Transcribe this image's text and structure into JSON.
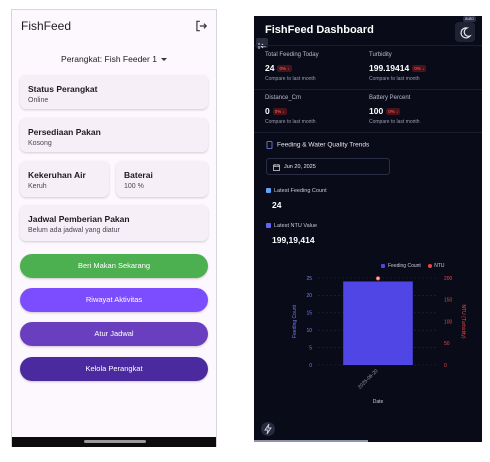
{
  "left_app": {
    "title": "FishFeed",
    "device_selector": "Perangkat: Fish Feeder 1",
    "cards": {
      "status": {
        "title": "Status Perangkat",
        "value": "Online"
      },
      "feed": {
        "title": "Persediaan Pakan",
        "value": "Kosong"
      },
      "turbidity": {
        "title": "Kekeruhan Air",
        "value": "Keruh"
      },
      "battery": {
        "title": "Baterai",
        "value": "100 %"
      },
      "schedule": {
        "title": "Jadwal Pemberian Pakan",
        "value": "Belum ada jadwal yang diatur"
      }
    },
    "buttons": {
      "feed_now": "Beri Makan Sekarang",
      "history": "Riwayat Aktivitas",
      "set_schedule": "Atur Jadwal",
      "manage_device": "Kelola Perangkat"
    },
    "colors": {
      "feed_now": "#4caf50",
      "history": "#7c4dff",
      "set_schedule": "#6a3fbf",
      "manage_device": "#4a2a9e"
    }
  },
  "right_app": {
    "title": "FishFeed Dashboard",
    "theme_badge": "auto",
    "stats": {
      "total_feeding": {
        "label": "Total Feeding Today",
        "value": "24",
        "change": "0%",
        "compare": "Compare to last month"
      },
      "turbidity": {
        "label": "Turbidity",
        "value": "199.19414",
        "change": "0%",
        "compare": "Compare to last month"
      },
      "distance": {
        "label": "Distance_Cm",
        "value": "0",
        "change": "0%",
        "compare": "Compare to last month"
      },
      "battery": {
        "label": "Battery Percent",
        "value": "100",
        "change": "0%",
        "compare": "Compare to last month"
      }
    },
    "section_title": "Feeding & Water Quality Trends",
    "date": "Jun 20, 2025",
    "latest_feeding": {
      "label": "Latest Feeding Count",
      "value": "24"
    },
    "latest_ntu": {
      "label": "Latest NTU Value",
      "value": "199,19,414"
    },
    "legend": {
      "feeding": "Feeding Count",
      "ntu": "NTU"
    },
    "colors": {
      "feeding": "#4f46e5",
      "ntu": "#ef4444",
      "feeding_swatch": "#60a5fa"
    }
  },
  "chart_data": {
    "type": "bar",
    "categories": [
      "2025-06-20"
    ],
    "series": [
      {
        "name": "Feeding Count",
        "values": [
          24
        ],
        "axis": "left",
        "type": "bar"
      },
      {
        "name": "NTU",
        "values": [
          199.19414
        ],
        "axis": "right",
        "type": "point"
      }
    ],
    "xlabel": "Date",
    "ylabel": "Feeding Count",
    "y2label": "NTU (Turbidity)",
    "ylim": [
      0,
      25
    ],
    "y2lim": [
      0,
      200
    ],
    "yticks": [
      "0",
      "5",
      "10",
      "15",
      "20",
      "25"
    ],
    "y2ticks": [
      "0",
      "50",
      "100",
      "150",
      "200"
    ],
    "grid": true,
    "legend": "top-right"
  }
}
